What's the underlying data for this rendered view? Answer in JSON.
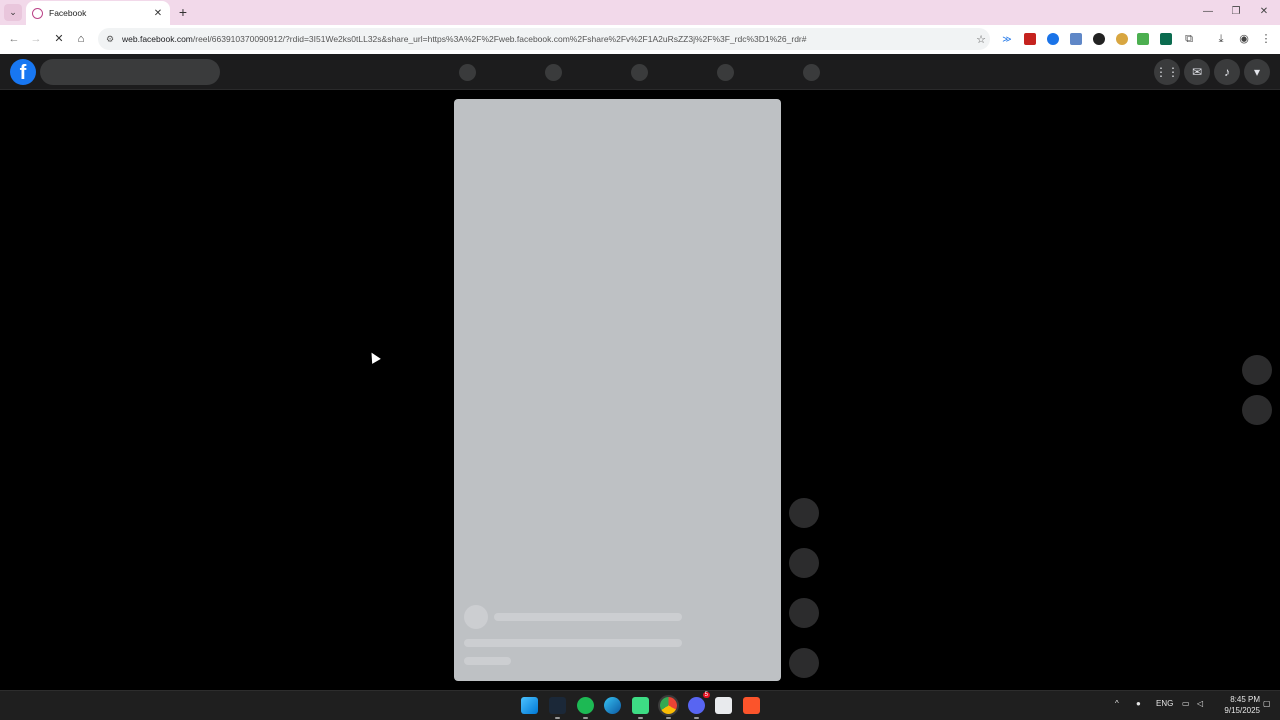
{
  "browser": {
    "tab": {
      "title": "Facebook"
    },
    "address_bar": {
      "host": "web.facebook.com",
      "path": "/reel/663910370090912/?rdid=3I51We2ks0tLL32s&share_url=https%3A%2F%2Fweb.facebook.com%2Fshare%2Fv%2F1A2uRsZZ3j%2F%3F_rdc%3D1%26_rdr#"
    }
  },
  "facebook": {
    "logo_letter": "f",
    "brand_color": "#1877f2",
    "page_state": "loading-skeleton"
  },
  "taskbar": {
    "lang": "ENG",
    "time": "8:45 PM",
    "date": "9/15/2025",
    "apps": [
      "windows-start",
      "steam",
      "spotify",
      "edge",
      "android-studio",
      "chrome",
      "discord",
      "notepad",
      "brave"
    ],
    "discord_badge": "5"
  }
}
